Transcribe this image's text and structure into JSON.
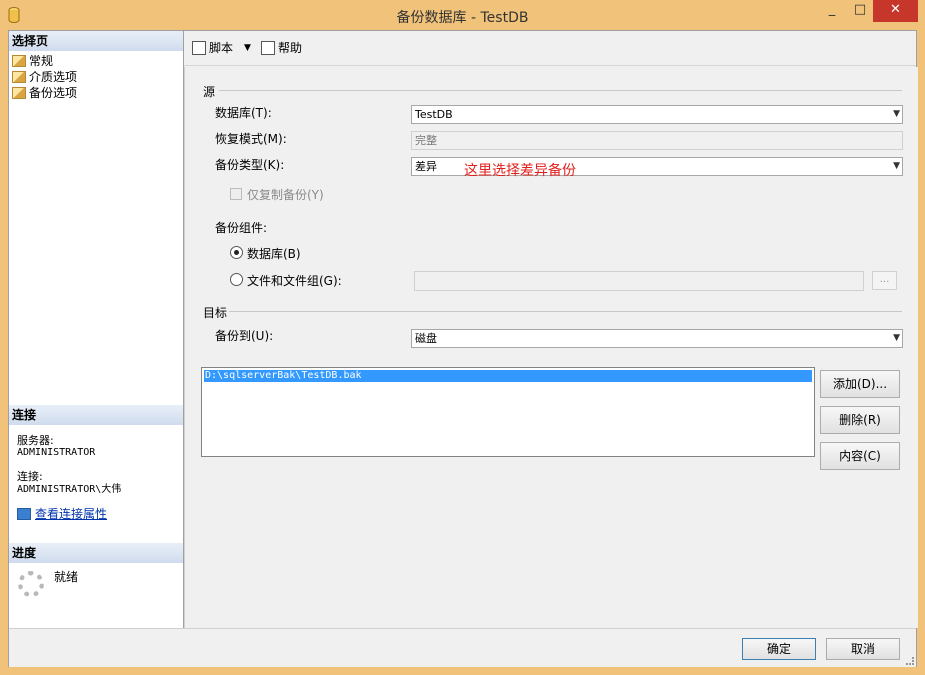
{
  "window": {
    "title": "备份数据库 - TestDB",
    "minimize": "_",
    "maximize": "□",
    "close": "✕"
  },
  "sidebar": {
    "select_page_header": "选择页",
    "pages": [
      {
        "label": "常规"
      },
      {
        "label": "介质选项"
      },
      {
        "label": "备份选项"
      }
    ],
    "connection_header": "连接",
    "server_label": "服务器:",
    "server_value": "ADMINISTRATOR",
    "connection_label": "连接:",
    "connection_value": "ADMINISTRATOR\\大伟",
    "view_connection_link": "查看连接属性",
    "progress_header": "进度",
    "progress_status": "就绪"
  },
  "toolbar": {
    "script_label": "脚本",
    "dropdown_arrow": "▼",
    "help_label": "帮助"
  },
  "source": {
    "group_title": "源",
    "database_label": "数据库(T):",
    "database_value": "TestDB",
    "recovery_label": "恢复模式(M):",
    "recovery_value": "完整",
    "backup_type_label": "备份类型(K):",
    "backup_type_value": "差异",
    "copy_only_label": "仅复制备份(Y)",
    "annotation": "这里选择差异备份",
    "component_label": "备份组件:",
    "component_database": "数据库(B)",
    "component_files": "文件和文件组(G):",
    "files_browse": "..."
  },
  "destination": {
    "group_title": "目标",
    "backup_to_label": "备份到(U):",
    "backup_to_value": "磁盘",
    "paths": [
      "D:\\sqlserverBak\\TestDB.bak"
    ],
    "add_button": "添加(D)...",
    "remove_button": "删除(R)",
    "contents_button": "内容(C)"
  },
  "footer": {
    "ok_button": "确定",
    "cancel_button": "取消"
  },
  "colors": {
    "frame": "#f1c27a",
    "close_button": "#c7362b",
    "annotation": "#e0201c",
    "selection": "#3399ff"
  }
}
